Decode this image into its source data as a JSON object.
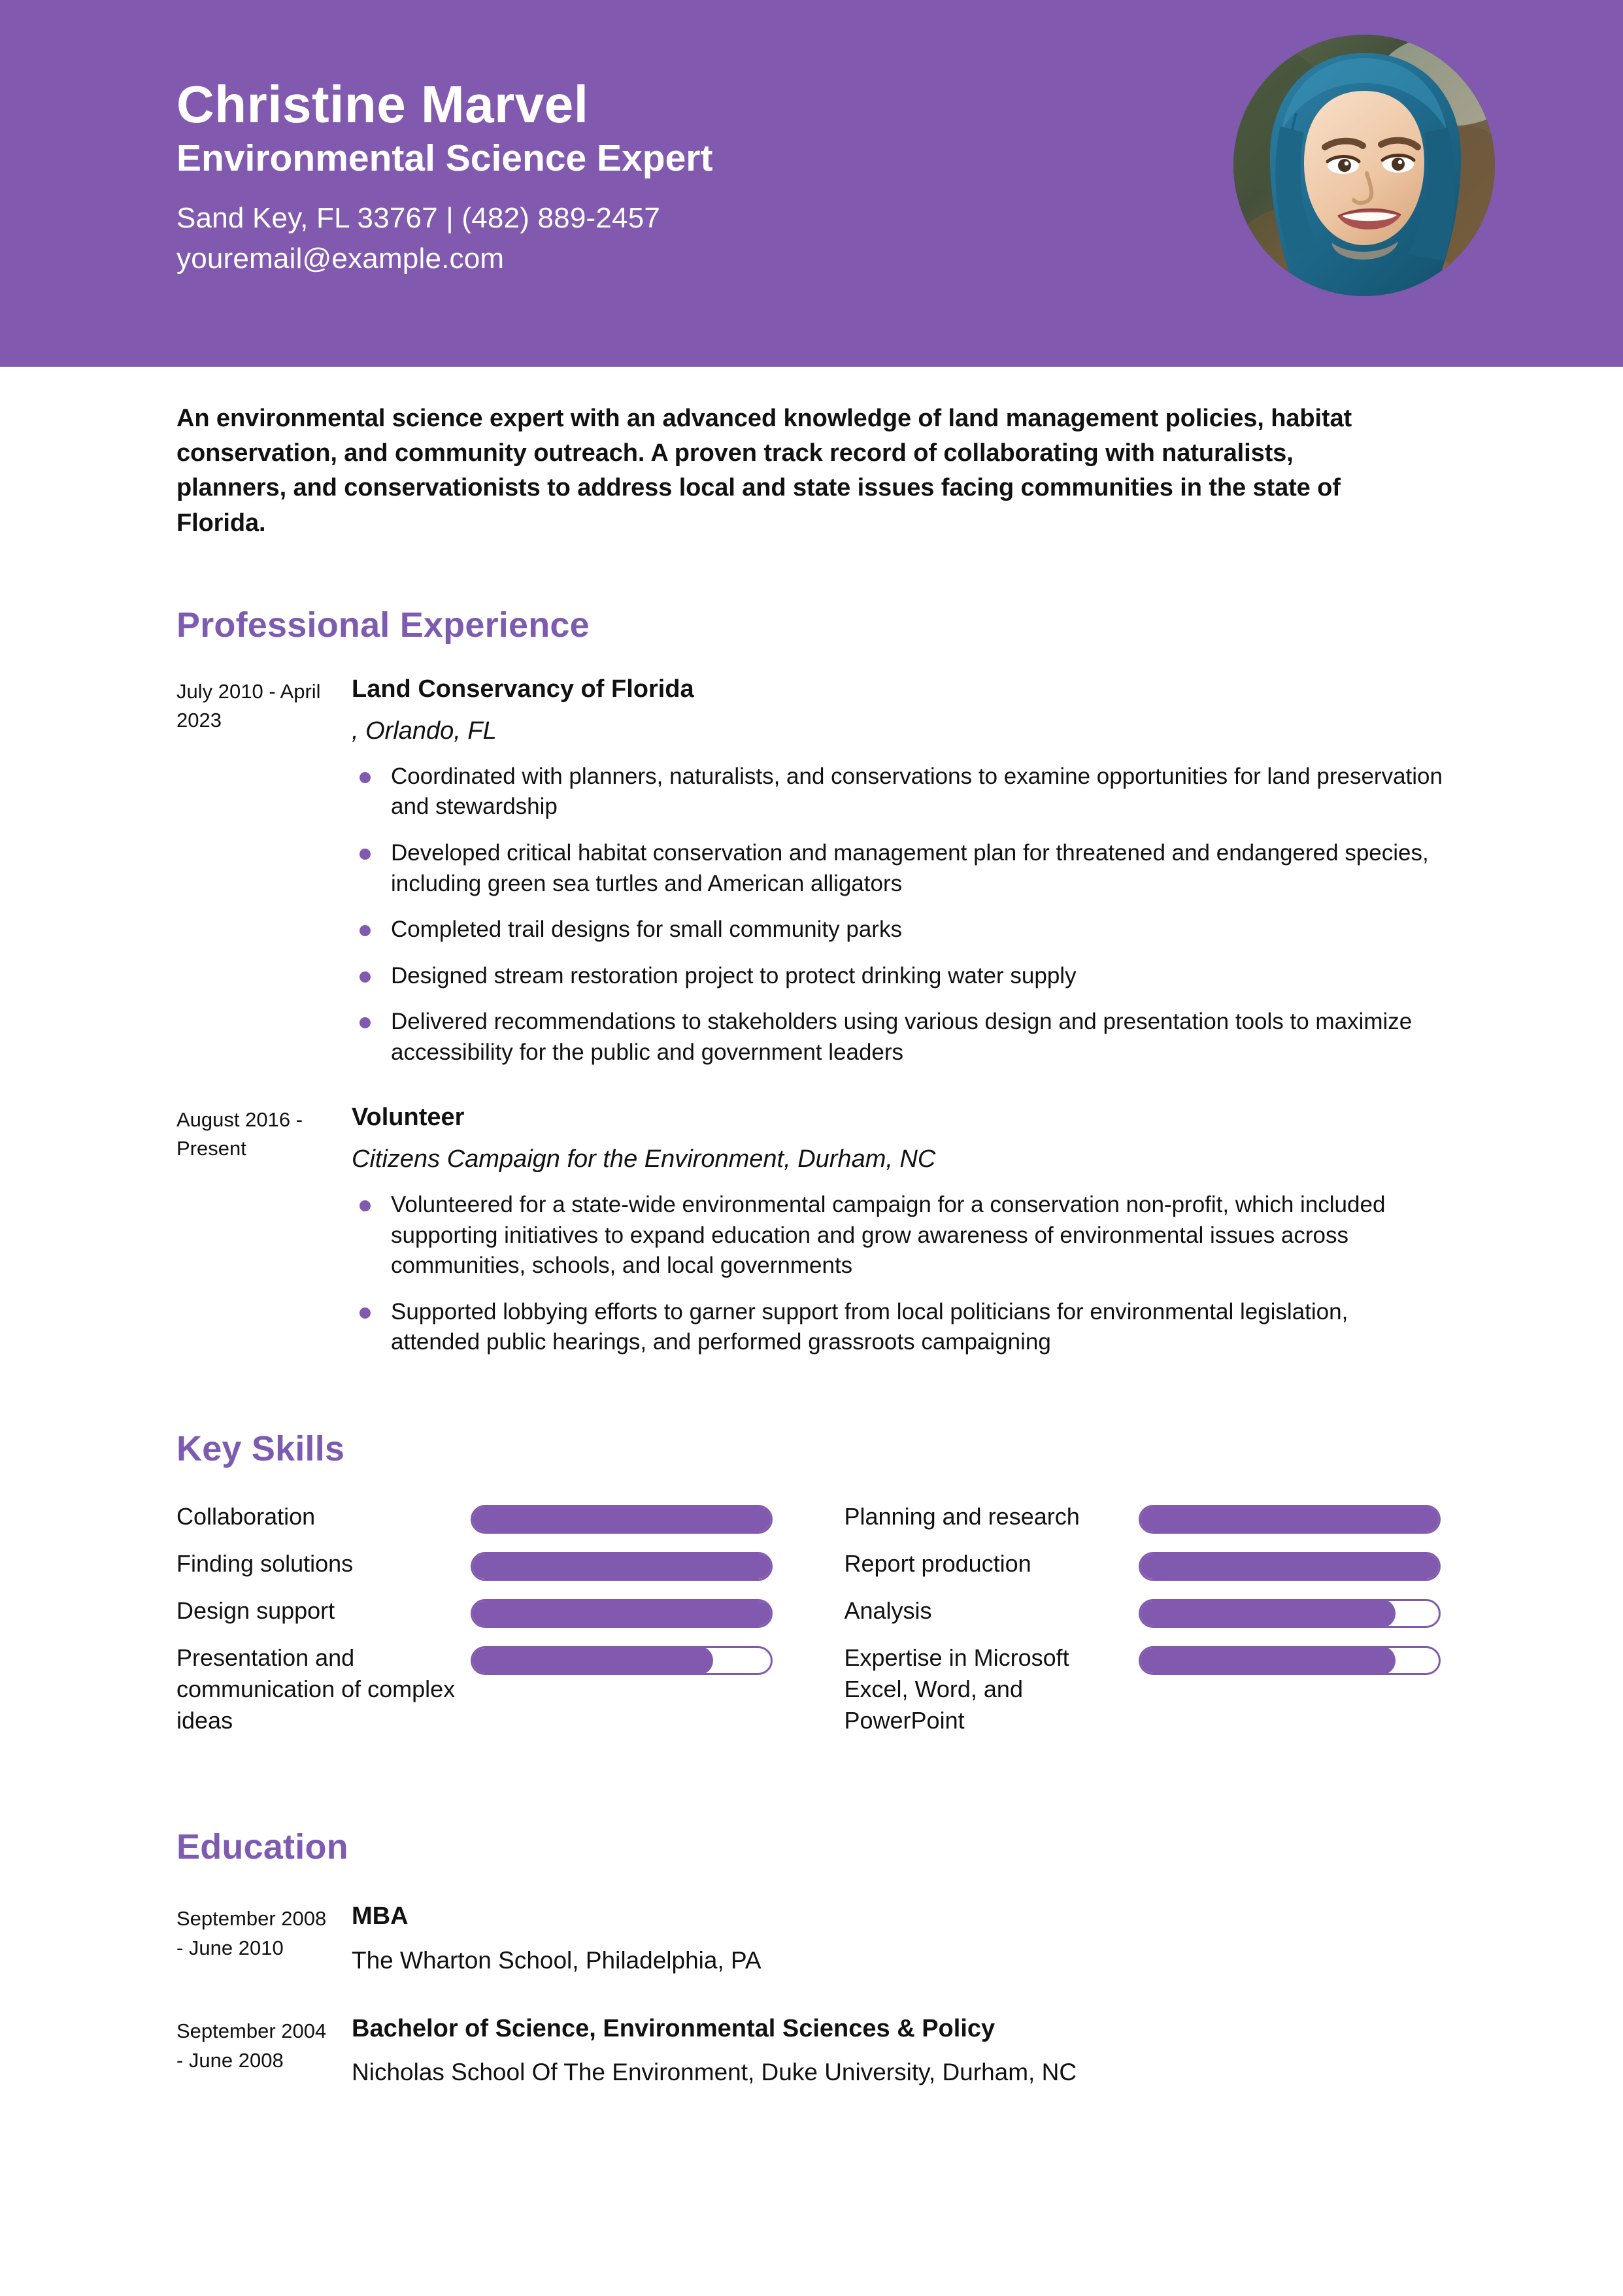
{
  "theme": {
    "header_bg": "#8159AE",
    "accent": "#7C5BB0",
    "bar_color": "#8159AE",
    "bullet_color": "#8159AE",
    "text_color": "#111111",
    "page_bg": "#ffffff"
  },
  "header": {
    "name": "Christine Marvel",
    "job_title": "Environmental Science Expert",
    "contact_line_1": "Sand Key, FL 33767 | (482) 889-2457",
    "contact_line_2": "youremail@example.com",
    "photo_alt": "portrait-photo"
  },
  "summary": {
    "text": "An environmental science expert with an advanced knowledge of land management policies, habitat conservation, and community outreach. A proven track record of collaborating with naturalists, planners, and conservationists to address local and state issues facing communities in the state of Florida."
  },
  "sections": {
    "experience_heading": "Professional Experience",
    "skills_heading": "Key Skills",
    "education_heading": "Education"
  },
  "experience": [
    {
      "dates": "July 2010 - April 2023",
      "organization": "Land Conservancy of Florida",
      "location": ", Orlando, FL",
      "bullets": [
        "Coordinated with planners, naturalists, and conservations to examine opportunities for land preservation and stewardship",
        "Developed critical habitat conservation and management plan for threatened and endangered species, including green sea turtles and American alligators",
        "Completed trail designs for small community parks",
        "Designed stream restoration project to protect drinking water supply",
        "Delivered recommendations to stakeholders using various design and presentation tools to maximize accessibility for the public and government leaders"
      ]
    },
    {
      "dates": "August 2016 - Present",
      "organization": "Volunteer",
      "location": "Citizens Campaign for the Environment, Durham, NC",
      "bullets": [
        "Volunteered for a state-wide environmental campaign for a conservation non-profit, which included supporting initiatives to expand education and grow awareness of environmental issues across communities, schools, and local governments",
        "Supported lobbying efforts to garner support from local politicians for environmental legislation, attended public hearings, and performed grassroots campaigning"
      ]
    }
  ],
  "skills": {
    "left_column": [
      {
        "label": "Collaboration",
        "level": 100
      },
      {
        "label": "Finding solutions",
        "level": 100
      },
      {
        "label": "Design support",
        "level": 100
      },
      {
        "label": "Presentation and communication of complex ideas",
        "level": 80
      }
    ],
    "right_column": [
      {
        "label": "Planning and research",
        "level": 100
      },
      {
        "label": "Report production",
        "level": 100
      },
      {
        "label": "Analysis",
        "level": 85
      },
      {
        "label": "Expertise in Microsoft Excel, Word, and PowerPoint",
        "level": 85
      }
    ]
  },
  "education": [
    {
      "dates": "September 2008 - June 2010",
      "degree": "MBA",
      "school": "The Wharton School, Philadelphia, PA"
    },
    {
      "dates": "September 2004 - June 2008",
      "degree": "Bachelor of Science, Environmental Sciences & Policy",
      "school": "Nicholas School Of The Environment, Duke University, Durham, NC"
    }
  ]
}
